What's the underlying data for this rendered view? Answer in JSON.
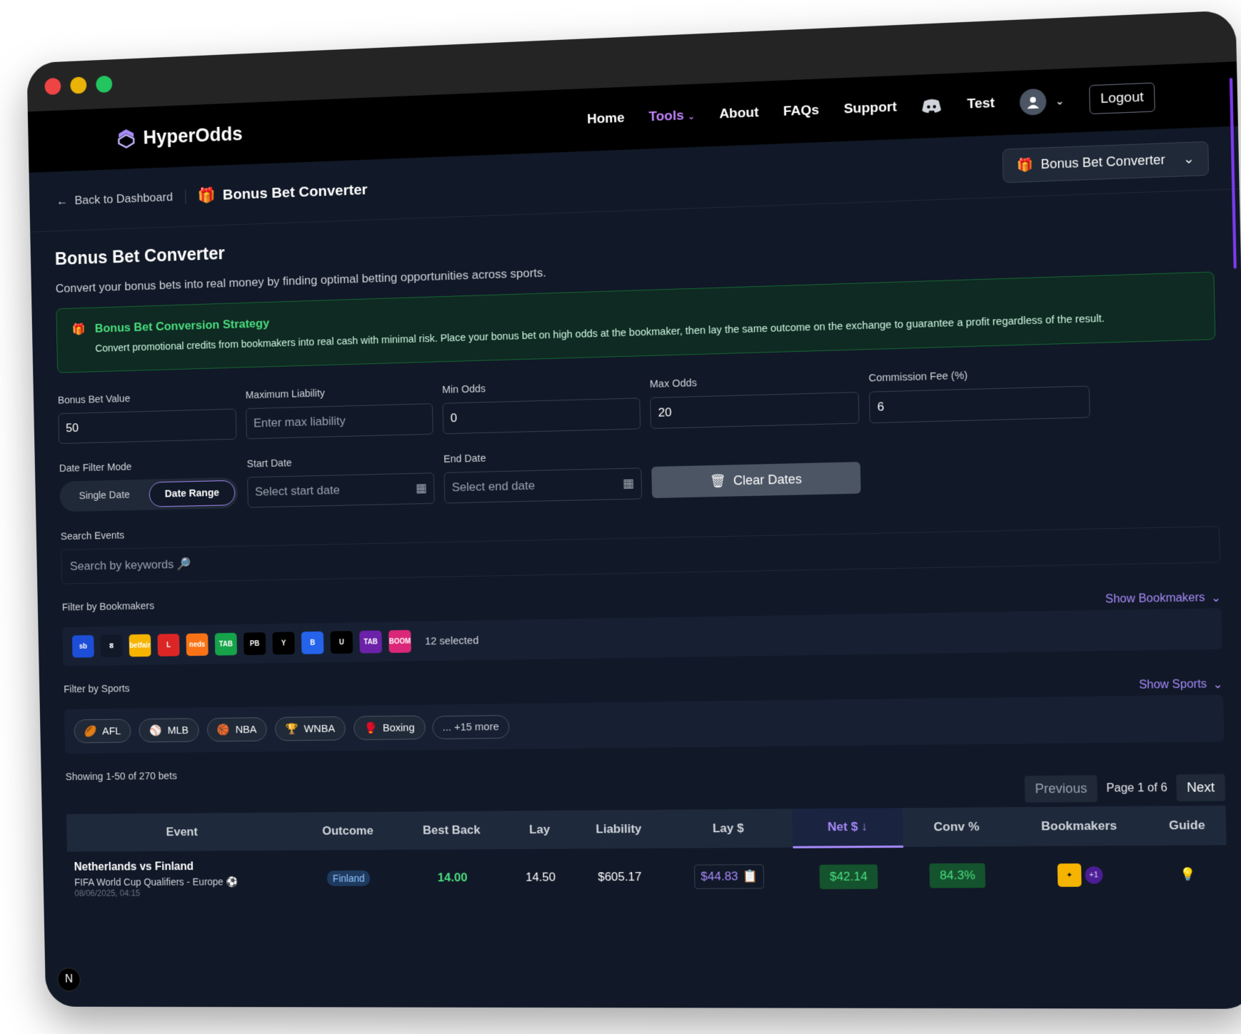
{
  "brand": {
    "name": "HyperOdds"
  },
  "nav": {
    "home": "Home",
    "tools": "Tools",
    "about": "About",
    "faqs": "FAQs",
    "support": "Support",
    "user": "Test",
    "logout": "Logout"
  },
  "subheader": {
    "back": "Back to Dashboard",
    "title": "Bonus Bet Converter",
    "tool_select": "Bonus Bet Converter"
  },
  "page": {
    "title": "Bonus Bet Converter",
    "description": "Convert your bonus bets into real money by finding optimal betting opportunities across sports."
  },
  "strategy": {
    "title": "Bonus Bet Conversion Strategy",
    "text": "Convert promotional credits from bookmakers into real cash with minimal risk. Place your bonus bet on high odds at the bookmaker, then lay the same outcome on the exchange to guarantee a profit regardless of the result."
  },
  "fields": {
    "bonus_value": {
      "label": "Bonus Bet Value",
      "value": "50"
    },
    "max_liability": {
      "label": "Maximum Liability",
      "placeholder": "Enter max liability"
    },
    "min_odds": {
      "label": "Min Odds",
      "value": "0"
    },
    "max_odds": {
      "label": "Max Odds",
      "value": "20"
    },
    "commission": {
      "label": "Commission Fee (%)",
      "value": "6"
    }
  },
  "dates": {
    "mode_label": "Date Filter Mode",
    "single": "Single Date",
    "range": "Date Range",
    "start_label": "Start Date",
    "start_placeholder": "Select start date",
    "end_label": "End Date",
    "end_placeholder": "Select end date",
    "clear": "Clear Dates"
  },
  "search": {
    "label": "Search Events",
    "placeholder": "Search by keywords 🔎"
  },
  "bookmakers": {
    "label": "Filter by Bookmakers",
    "show": "Show Bookmakers",
    "selected": "12 selected",
    "logos": [
      {
        "text": "sb",
        "color": "#1d4ed8"
      },
      {
        "text": "ⵓ",
        "color": "#111827"
      },
      {
        "text": "betfair",
        "color": "#f5b400"
      },
      {
        "text": "L",
        "color": "#dc2626"
      },
      {
        "text": "neds",
        "color": "#f97316"
      },
      {
        "text": "TAB",
        "color": "#16a34a"
      },
      {
        "text": "PB",
        "color": "#000000"
      },
      {
        "text": "Y",
        "color": "#000000"
      },
      {
        "text": "B",
        "color": "#2563eb"
      },
      {
        "text": "U",
        "color": "#000000"
      },
      {
        "text": "TAB",
        "color": "#6b21a8"
      },
      {
        "text": "BOOM",
        "color": "#db2777"
      }
    ]
  },
  "sports": {
    "label": "Filter by Sports",
    "show": "Show Sports",
    "items": [
      {
        "icon": "🏉",
        "name": "AFL"
      },
      {
        "icon": "⚾",
        "name": "MLB"
      },
      {
        "icon": "🏀",
        "name": "NBA"
      },
      {
        "icon": "🏆",
        "name": "WNBA"
      },
      {
        "icon": "🥊",
        "name": "Boxing"
      }
    ],
    "more": "... +15 more"
  },
  "results": {
    "showing": "Showing 1-50 of 270 bets",
    "previous": "Previous",
    "page": "Page 1 of 6",
    "next": "Next"
  },
  "table": {
    "headers": [
      "Event",
      "Outcome",
      "Best Back",
      "Lay",
      "Liability",
      "Lay $",
      "Net $ ↓",
      "Conv %",
      "Bookmakers",
      "Guide"
    ],
    "rows": [
      {
        "event": "Netherlands vs Finland",
        "league": "FIFA World Cup Qualifiers - Europe",
        "date": "08/06/2025, 04:15",
        "outcome": "Finland",
        "best_back": "14.00",
        "lay": "14.50",
        "liability": "$605.17",
        "lay_stake": "$44.83",
        "net": "$42.14",
        "conv": "84.3%",
        "more_bookmakers": "+1"
      }
    ]
  },
  "colors": {
    "accent": "#a78bfa",
    "positive": "#4ade80",
    "background": "#111827"
  }
}
